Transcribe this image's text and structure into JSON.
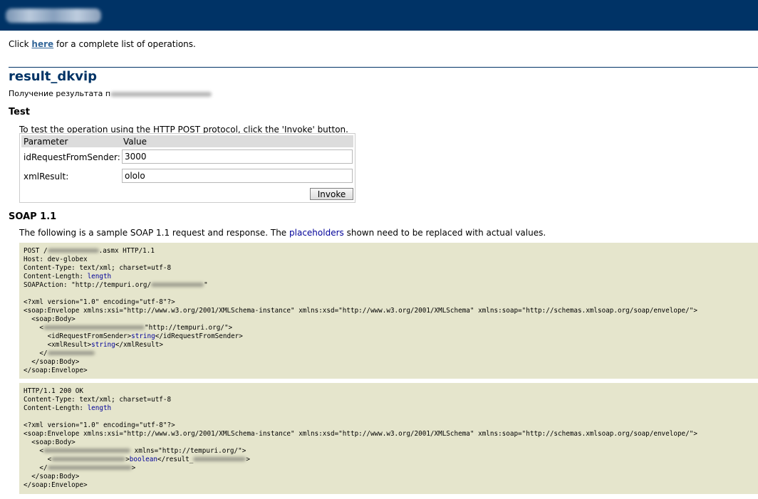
{
  "intro": {
    "prefix": "Click ",
    "link": "here",
    "suffix": " for a complete list of operations."
  },
  "operation": {
    "name": "result_dkvip",
    "description": "Получение результата п"
  },
  "test": {
    "heading": "Test",
    "instructions": "To test the operation using the HTTP POST protocol, click the 'Invoke' button.",
    "col_parameter": "Parameter",
    "col_value": "Value",
    "params": [
      {
        "label": "idRequestFromSender:",
        "value": "3000"
      },
      {
        "label": "xmlResult:",
        "value": "ololo"
      }
    ],
    "invoke_label": "Invoke"
  },
  "soap11": {
    "heading": "SOAP 1.1",
    "intro_prefix": "The following is a sample SOAP 1.1 request and response. The ",
    "intro_placeholders": "placeholders",
    "intro_suffix": " shown need to be replaced with actual values.",
    "request": {
      "line_post_a": "POST /",
      "line_post_b": ".asmx HTTP/1.1",
      "line_host": "Host: dev-globex",
      "line_ctype": "Content-Type: text/xml; charset=utf-8",
      "line_clen": "Content-Length: ",
      "ph_length": "length",
      "line_action_a": "SOAPAction: \"http://tempuri.org/",
      "line_action_b": "\"",
      "line_xmldecl": "<?xml version=\"1.0\" encoding=\"utf-8\"?>",
      "line_envelope": "<soap:Envelope xmlns:xsi=\"http://www.w3.org/2001/XMLSchema-instance\" xmlns:xsd=\"http://www.w3.org/2001/XMLSchema\" xmlns:soap=\"http://schemas.xmlsoap.org/soap/envelope/\">",
      "line_body_open": "  <soap:Body>",
      "line_op_open_a": "    <",
      "line_op_open_b": "\"http://tempuri.org/\">",
      "line_id_a": "      <idRequestFromSender>",
      "ph_string": "string",
      "line_id_b": "</idRequestFromSender>",
      "line_xml_a": "      <xmlResult>",
      "line_xml_b": "</xmlResult>",
      "line_op_close_a": "    </",
      "line_body_close": "  </soap:Body>",
      "line_envelope_close": "</soap:Envelope>"
    },
    "response": {
      "line_status": "HTTP/1.1 200 OK",
      "line_ctype": "Content-Type: text/xml; charset=utf-8",
      "line_clen": "Content-Length: ",
      "ph_length": "length",
      "line_xmldecl": "<?xml version=\"1.0\" encoding=\"utf-8\"?>",
      "line_envelope": "<soap:Envelope xmlns:xsi=\"http://www.w3.org/2001/XMLSchema-instance\" xmlns:xsd=\"http://www.w3.org/2001/XMLSchema\" xmlns:soap=\"http://schemas.xmlsoap.org/soap/envelope/\">",
      "line_body_open": "  <soap:Body>",
      "line_op_open_a": "    <",
      "line_op_open_b": " xmlns=\"http://tempuri.org/\">",
      "line_res_a": "      <",
      "line_res_b": ">",
      "ph_boolean": "boolean",
      "line_res_c": "</result_",
      "line_op_close_a": "    </",
      "line_body_close": "  </soap:Body>",
      "line_envelope_close": "</soap:Envelope>"
    }
  },
  "colors": {
    "header": "#003366",
    "heading": "#003366",
    "link": "#336699",
    "placeholder": "#000099",
    "code_bg": "#e5e5cc"
  }
}
